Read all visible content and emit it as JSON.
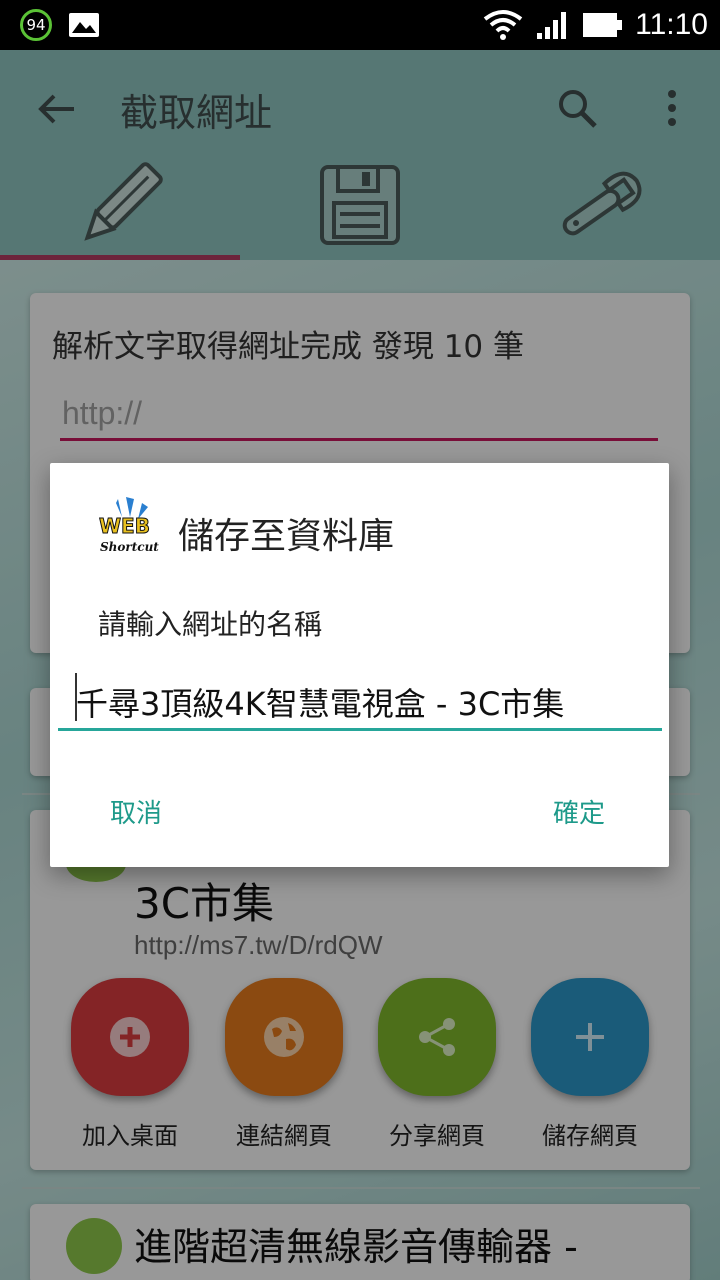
{
  "status_bar": {
    "battery_level": "94",
    "time": "11:10"
  },
  "app_bar": {
    "title": "截取網址"
  },
  "tabs": [
    {
      "name": "edit",
      "icon": "pencil-icon"
    },
    {
      "name": "save",
      "icon": "floppy-disk-icon"
    },
    {
      "name": "settings",
      "icon": "wrench-icon"
    }
  ],
  "card1": {
    "title": "解析文字取得網址完成 發現 10 筆",
    "url_placeholder": "http://"
  },
  "item1": {
    "title": "3C市集",
    "url": "http://ms7.tw/D/rdQW",
    "actions": [
      {
        "label": "加入桌面",
        "color": "#d63a3e",
        "icon": "add-circle-icon"
      },
      {
        "label": "連結網頁",
        "color": "#e0781c",
        "icon": "globe-icon"
      },
      {
        "label": "分享網頁",
        "color": "#7cb32a",
        "icon": "share-icon"
      },
      {
        "label": "儲存網頁",
        "color": "#2a94c4",
        "icon": "plus-icon"
      }
    ]
  },
  "item2": {
    "title": "進階超清無線影音傳輸器 -"
  },
  "dialog": {
    "title": "儲存至資料庫",
    "message": "請輸入網址的名稱",
    "input_value": "千尋3頂級4K智慧電視盒 - 3C市集",
    "cancel_label": "取消",
    "ok_label": "確定"
  },
  "colors": {
    "accent": "#26a69a",
    "tab_indicator": "#c2185b",
    "app_bar": "#8cc0bc"
  }
}
